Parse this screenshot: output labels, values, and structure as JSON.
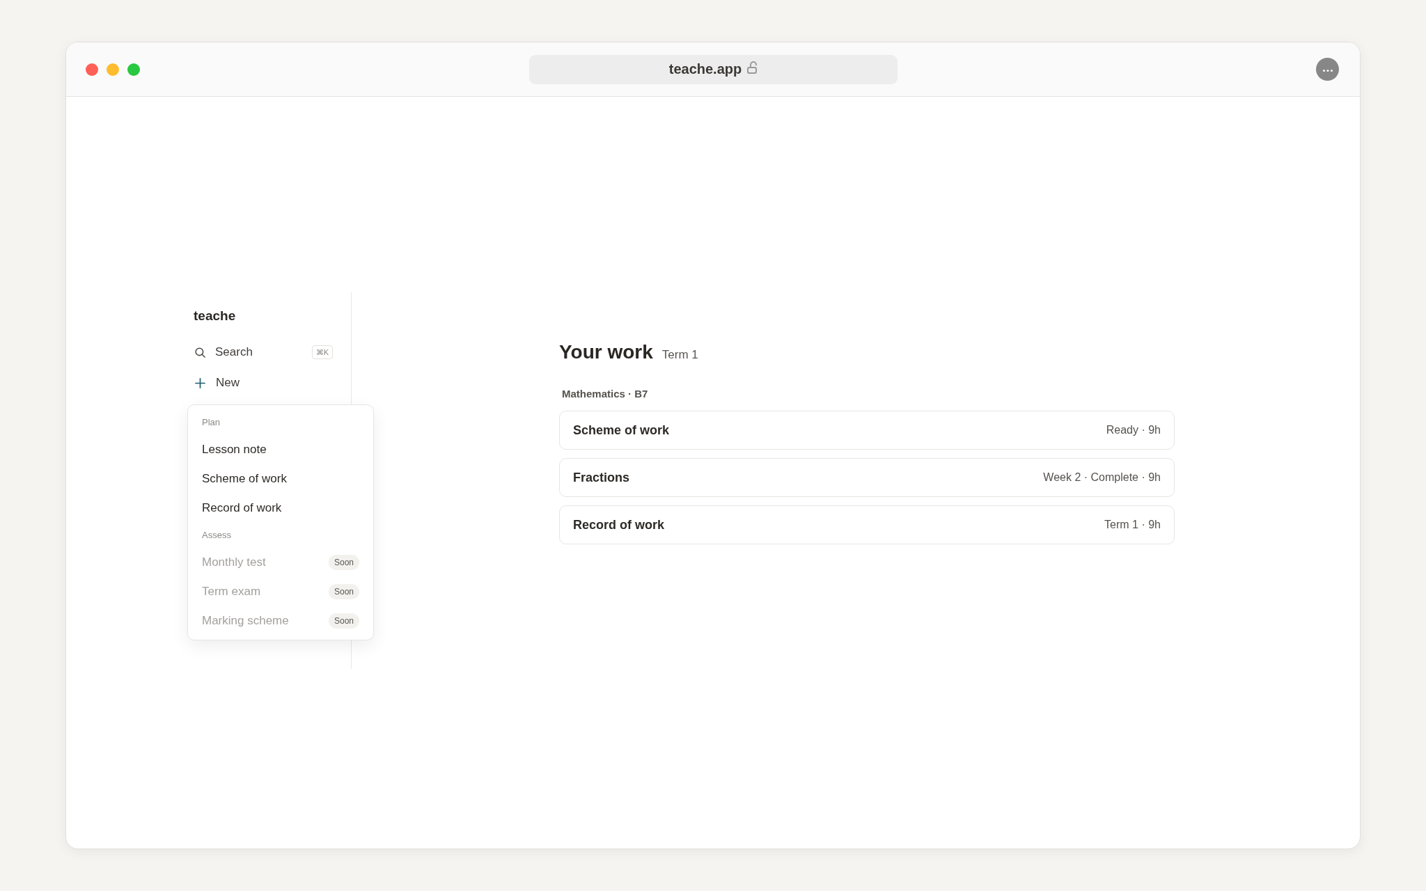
{
  "browser": {
    "url": "teache.app"
  },
  "sidebar": {
    "brand": "teache",
    "search": {
      "label": "Search",
      "shortcut": "⌘K"
    },
    "new_button": {
      "label": "New"
    }
  },
  "new_menu": {
    "groups": [
      {
        "heading": "Plan",
        "items": [
          {
            "label": "Lesson note",
            "disabled": false
          },
          {
            "label": "Scheme of work",
            "disabled": false
          },
          {
            "label": "Record of work",
            "disabled": false
          }
        ]
      },
      {
        "heading": "Assess",
        "items": [
          {
            "label": "Monthly test",
            "disabled": true,
            "badge": "Soon"
          },
          {
            "label": "Term exam",
            "disabled": true,
            "badge": "Soon"
          },
          {
            "label": "Marking scheme",
            "disabled": true,
            "badge": "Soon"
          }
        ]
      }
    ]
  },
  "main": {
    "title": "Your work",
    "subtitle": "Term 1",
    "section_label": "Mathematics · B7",
    "cards": [
      {
        "title": "Scheme of work",
        "meta": "Ready · 9h"
      },
      {
        "title": "Fractions",
        "meta": "Week 2 · Complete · 9h"
      },
      {
        "title": "Record of work",
        "meta": "Term 1 · 9h"
      }
    ]
  }
}
